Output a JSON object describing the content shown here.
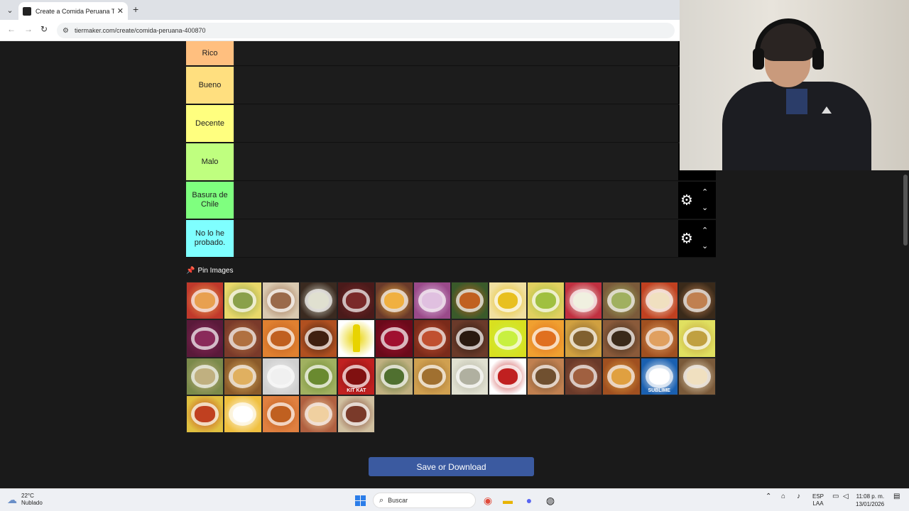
{
  "browser": {
    "tab_title": "Create a Comida Peruana Tier L",
    "url": "tiermaker.com/create/comida-peruana-400870"
  },
  "tiers": [
    {
      "label": "Rico",
      "color": "#ffbf7f"
    },
    {
      "label": "Bueno",
      "color": "#ffdf7f"
    },
    {
      "label": "Decente",
      "color": "#ffff7f"
    },
    {
      "label": "Malo",
      "color": "#bfff7f"
    },
    {
      "label": "Basura de Chile",
      "color": "#7fff7f"
    },
    {
      "label": "No lo he probado.",
      "color": "#7fffff"
    }
  ],
  "pin": {
    "label": "Pin Images"
  },
  "images": {
    "count": 47,
    "special": {
      "32": "KIT KAT",
      "40": "SUBLIME"
    }
  },
  "save_button": "Save or Download",
  "taskbar": {
    "weather_temp": "22°C",
    "weather_desc": "Nublado",
    "search_placeholder": "Buscar",
    "lang_top": "ESP",
    "lang_bottom": "LAA",
    "time": "11:08 p. m.",
    "date": "13/01/2026"
  }
}
